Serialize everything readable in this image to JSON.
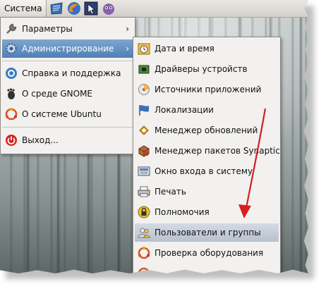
{
  "panel": {
    "menu_system": "Система",
    "launchers": [
      "notes-icon",
      "firefox-icon",
      "screenshot-icon",
      "pidgin-icon"
    ]
  },
  "main_menu": {
    "items": [
      {
        "label": "Параметры",
        "icon": "wrench-icon",
        "submenu": true
      },
      {
        "label": "Администрирование",
        "icon": "gear-icon",
        "submenu": true,
        "selected": true
      },
      {
        "label": "Справка и поддержка",
        "icon": "help-icon"
      },
      {
        "label": "О среде GNOME",
        "icon": "gnome-foot-icon"
      },
      {
        "label": "О системе Ubuntu",
        "icon": "ubuntu-icon"
      },
      {
        "label": "Выход...",
        "icon": "power-icon"
      }
    ],
    "submenu_arrow": "›"
  },
  "admin_menu": {
    "items": [
      {
        "label": "Дата и время",
        "icon": "clock-icon"
      },
      {
        "label": "Драйверы устройств",
        "icon": "chip-icon"
      },
      {
        "label": "Источники приложений",
        "icon": "disc-icon"
      },
      {
        "label": "Локализации",
        "icon": "flag-icon"
      },
      {
        "label": "Менеджер обновлений",
        "icon": "update-icon"
      },
      {
        "label": "Менеджер пакетов Synaptic",
        "icon": "package-icon"
      },
      {
        "label": "Окно входа в систему",
        "icon": "login-screen-icon"
      },
      {
        "label": "Печать",
        "icon": "printer-icon"
      },
      {
        "label": "Полномочия",
        "icon": "lock-icon"
      },
      {
        "label": "Пользователи и группы",
        "icon": "users-icon",
        "highlighted": true
      },
      {
        "label": "Проверка оборудования",
        "icon": "ubuntu-icon"
      }
    ]
  },
  "colors": {
    "selection": "#5a86b9",
    "annotation_arrow": "#d42020"
  }
}
